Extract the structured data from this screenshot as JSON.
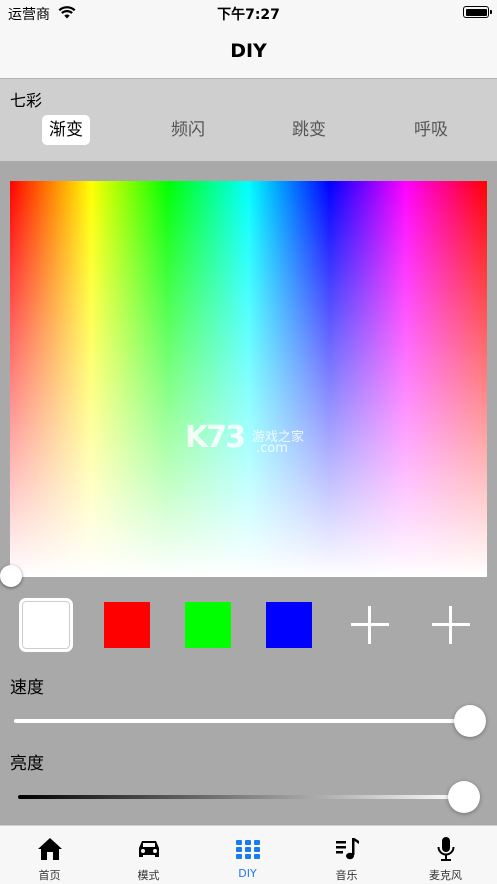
{
  "status_bar": {
    "carrier": "运营商",
    "time": "下午7:27"
  },
  "nav": {
    "title": "DIY"
  },
  "mode_panel": {
    "label": "七彩",
    "tabs": [
      {
        "label": "渐变",
        "active": true
      },
      {
        "label": "频闪",
        "active": false
      },
      {
        "label": "跳变",
        "active": false
      },
      {
        "label": "呼吸",
        "active": false
      }
    ]
  },
  "watermark": {
    "main": "K73",
    "sub": "游戏之家",
    "domain": ".com"
  },
  "swatches": [
    {
      "color": "#ffffff",
      "selected": true
    },
    {
      "color": "#ff0000",
      "selected": false
    },
    {
      "color": "#00ff00",
      "selected": false
    },
    {
      "color": "#0000ff",
      "selected": false
    },
    {
      "color": "add",
      "selected": false
    },
    {
      "color": "add",
      "selected": false
    }
  ],
  "speed": {
    "label": "速度",
    "value": 1.0
  },
  "brightness": {
    "label": "亮度",
    "value": 1.0
  },
  "tabbar": {
    "items": [
      {
        "label": "首页",
        "icon": "home-icon",
        "active": false
      },
      {
        "label": "模式",
        "icon": "car-icon",
        "active": false
      },
      {
        "label": "DIY",
        "icon": "grid-icon",
        "active": true
      },
      {
        "label": "音乐",
        "icon": "music-list-icon",
        "active": false
      },
      {
        "label": "麦克风",
        "icon": "microphone-icon",
        "active": false
      }
    ],
    "accent": "#1a7bf0"
  }
}
